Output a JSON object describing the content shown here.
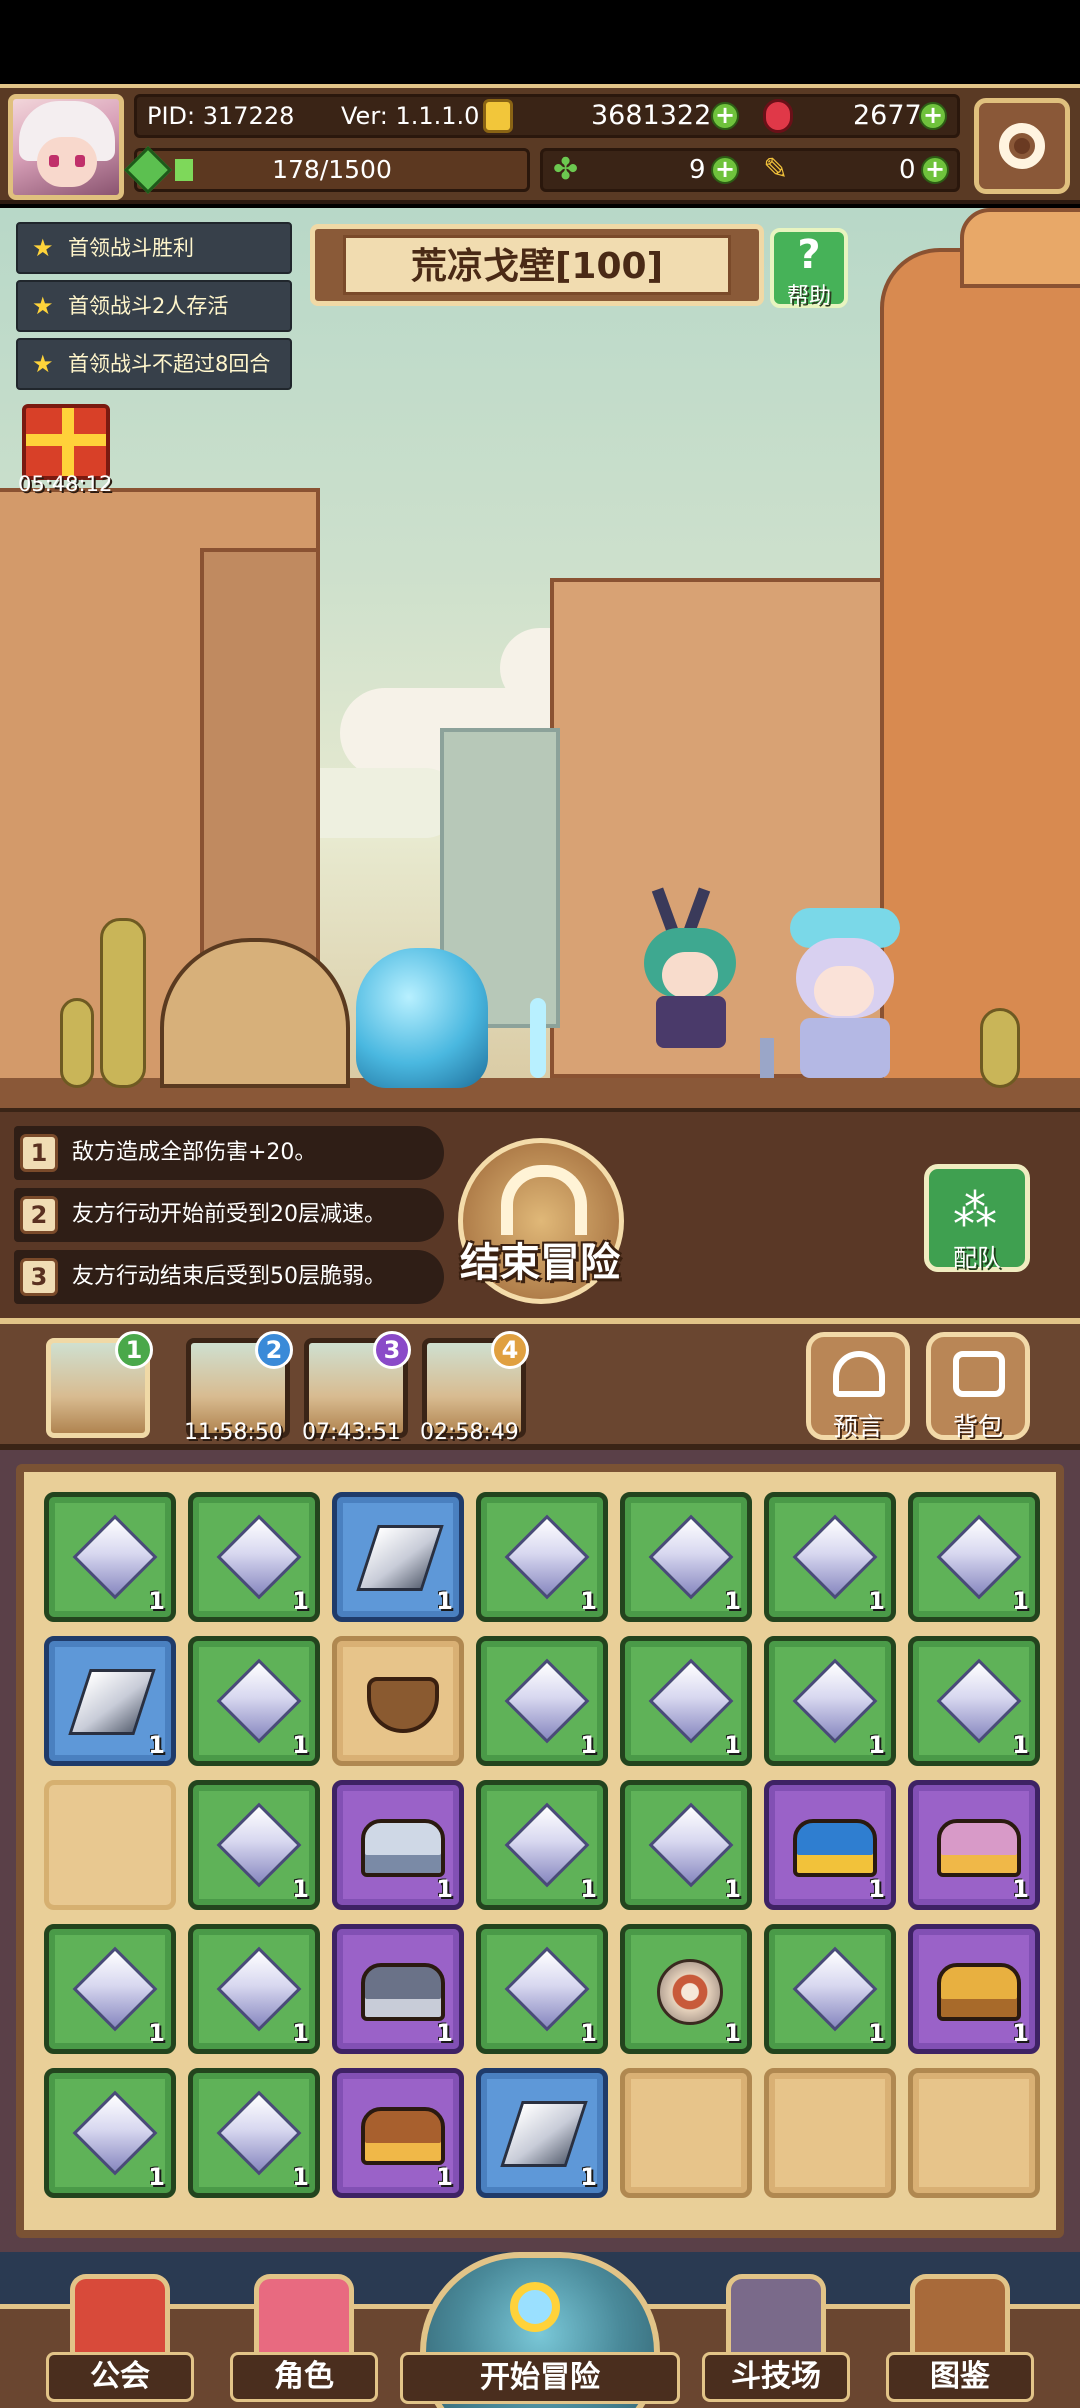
{
  "hud": {
    "pid": "PID: 317228",
    "version": "Ver: 1.1.1.0",
    "gold": "3681322",
    "gems": "2677",
    "stamina": "178/1500",
    "clover": "9",
    "tickets": "0"
  },
  "quests": [
    "首领战斗胜利",
    "首领战斗2人存活",
    "首领战斗不超过8回合"
  ],
  "stage": {
    "title": "荒凉戈壁[100]",
    "help_label": "帮助"
  },
  "gift_timer": "05:48:12",
  "effects": [
    {
      "num": "1",
      "text": "敌方造成全部伤害+20。"
    },
    {
      "num": "2",
      "text": "友方行动开始前受到20层减速。"
    },
    {
      "num": "3",
      "text": "友方行动结束后受到50层脆弱。"
    }
  ],
  "end_button_label": "结束冒险",
  "team_button_label": "配队",
  "slots": [
    {
      "badge": "1",
      "timer": ""
    },
    {
      "badge": "2",
      "timer": "11:58:50"
    },
    {
      "badge": "3",
      "timer": "07:43:51"
    },
    {
      "badge": "4",
      "timer": "02:58:49"
    }
  ],
  "side_buttons": {
    "prophecy": "预言",
    "backpack": "背包"
  },
  "inventory": {
    "rows": [
      [
        {
          "type": "gem",
          "color": "green",
          "qty": "1"
        },
        {
          "type": "gem",
          "color": "green",
          "qty": "1"
        },
        {
          "type": "crystal",
          "color": "blue",
          "qty": "1"
        },
        {
          "type": "gem",
          "color": "green",
          "qty": "1"
        },
        {
          "type": "gem",
          "color": "green",
          "qty": "1"
        },
        {
          "type": "gem",
          "color": "green",
          "qty": "1"
        },
        {
          "type": "gem",
          "color": "green",
          "qty": "1"
        }
      ],
      [
        {
          "type": "crystal",
          "color": "blue",
          "qty": "1"
        },
        {
          "type": "gem",
          "color": "green",
          "qty": "1"
        },
        {
          "type": "cauldron",
          "color": "gold",
          "qty": ""
        },
        {
          "type": "gem",
          "color": "green",
          "qty": "1"
        },
        {
          "type": "gem",
          "color": "green",
          "qty": "1"
        },
        {
          "type": "gem",
          "color": "green",
          "qty": "1"
        },
        {
          "type": "gem",
          "color": "green",
          "qty": "1"
        }
      ],
      [
        {
          "type": "empty",
          "color": "empty",
          "qty": ""
        },
        {
          "type": "gem",
          "color": "green",
          "qty": "1"
        },
        {
          "type": "chest-silver",
          "color": "purple",
          "qty": "1"
        },
        {
          "type": "gem",
          "color": "green",
          "qty": "1"
        },
        {
          "type": "gem",
          "color": "green",
          "qty": "1"
        },
        {
          "type": "chest-blue",
          "color": "purple",
          "qty": "1"
        },
        {
          "type": "chest-pink",
          "color": "purple",
          "qty": "1"
        }
      ],
      [
        {
          "type": "gem",
          "color": "green",
          "qty": "1"
        },
        {
          "type": "gem",
          "color": "green",
          "qty": "1"
        },
        {
          "type": "chest-iron",
          "color": "purple",
          "qty": "1"
        },
        {
          "type": "gem",
          "color": "green",
          "qty": "1"
        },
        {
          "type": "shield",
          "color": "green",
          "qty": "1"
        },
        {
          "type": "gem",
          "color": "green",
          "qty": "1"
        },
        {
          "type": "chest-gold",
          "color": "purple",
          "qty": "1"
        }
      ],
      [
        {
          "type": "gem",
          "color": "green",
          "qty": "1"
        },
        {
          "type": "gem",
          "color": "green",
          "qty": "1"
        },
        {
          "type": "chest-wood",
          "color": "purple",
          "qty": "1"
        },
        {
          "type": "crystal",
          "color": "blue",
          "qty": "1"
        },
        {
          "type": "empty",
          "color": "gold",
          "qty": ""
        },
        {
          "type": "empty",
          "color": "gold",
          "qty": ""
        },
        {
          "type": "empty",
          "color": "gold",
          "qty": ""
        }
      ]
    ]
  },
  "nav": {
    "guild": "公会",
    "character": "角色",
    "adventure": "开始冒险",
    "arena": "斗技场",
    "codex": "图鉴"
  }
}
